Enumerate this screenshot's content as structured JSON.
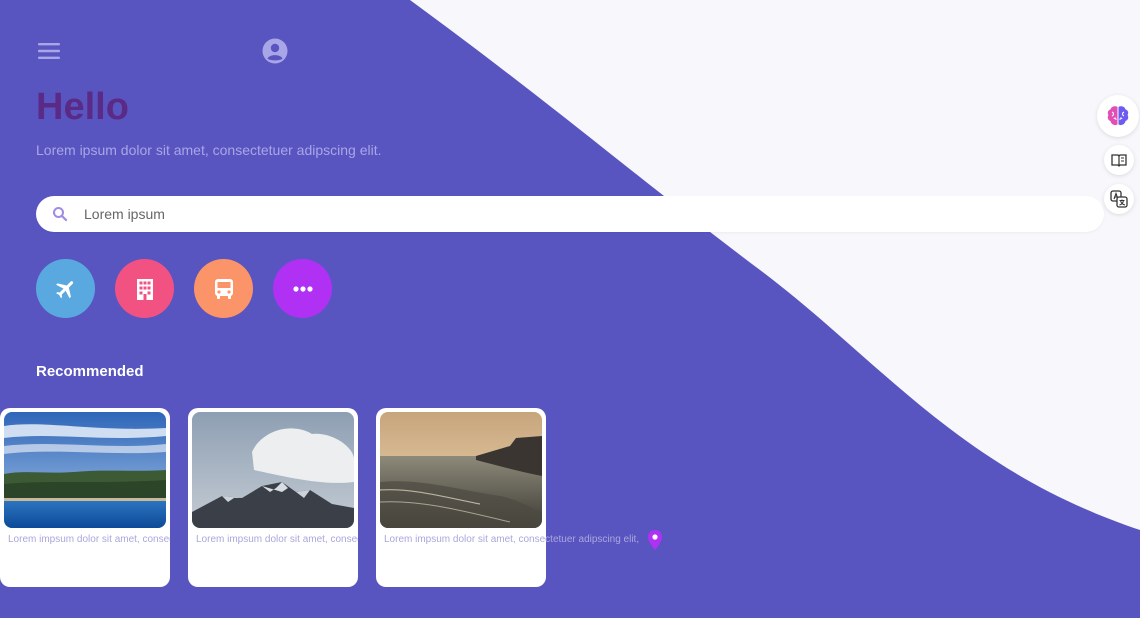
{
  "header": {
    "menu_icon": "menu-icon",
    "account_icon": "account-circle-icon"
  },
  "hero": {
    "title": "Hello",
    "subtitle": "Lorem ipsum dolor sit amet, consectetuer adipscing elit."
  },
  "search": {
    "placeholder": "Lorem ipsum",
    "icon": "search-icon"
  },
  "categories": [
    {
      "icon": "airplane-icon",
      "color": "#5aa8e0"
    },
    {
      "icon": "building-icon",
      "color": "#f25282"
    },
    {
      "icon": "bus-icon",
      "color": "#fb9468"
    },
    {
      "icon": "more-icon",
      "color": "#b031f4"
    }
  ],
  "recommended": {
    "heading": "Recommended",
    "cards": [
      {
        "image": "lake-forest-photo",
        "text": "Lorem impsum dolor sit amet, consectetuer adipscing elit,"
      },
      {
        "image": "snowy-mountain-photo",
        "text": "Lorem impsum dolor sit amet, consectetuer adipscing elit,"
      },
      {
        "image": "beach-sunset-photo",
        "text": "Lorem impsum dolor sit amet, consectetuer adipscing elit,"
      }
    ],
    "location_icon": "map-pin-icon"
  },
  "side_tools": [
    "brain-icon",
    "book-icon",
    "translate-icon"
  ],
  "colors": {
    "background": "#5855c0",
    "curve": "#f7f7fc",
    "title": "#5b2a86",
    "accent": "#b031f4"
  }
}
